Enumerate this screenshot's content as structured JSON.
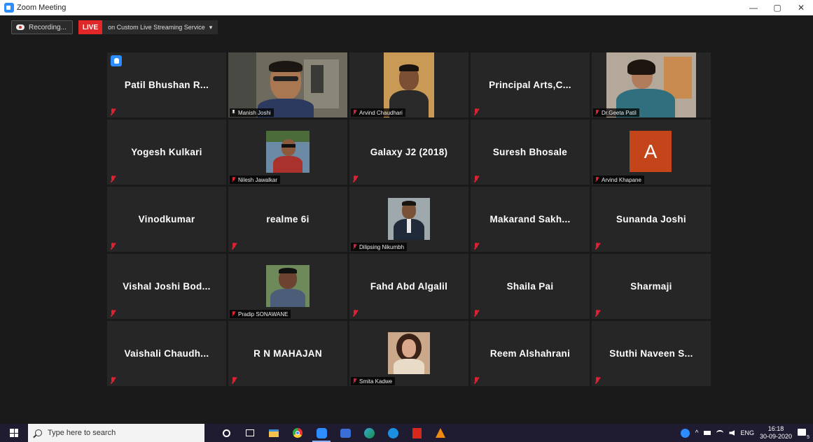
{
  "window": {
    "title": "Zoom Meeting",
    "controls": [
      "—",
      "▢",
      "✕"
    ]
  },
  "topbar": {
    "recording_label": "Recording...",
    "live_badge": "LIVE",
    "live_text": "on Custom Live Streaming Service",
    "live_caret": "▾"
  },
  "participants": [
    {
      "name": "Patil Bhushan R...",
      "type": "name",
      "hand_raised": true
    },
    {
      "name": "Manish Joshi",
      "type": "video",
      "active_speaker": true
    },
    {
      "name": "Arvind Chaudhari",
      "type": "photo"
    },
    {
      "name": "Principal Arts,C...",
      "type": "name"
    },
    {
      "name": "Dr.Geeta Patil",
      "type": "video"
    },
    {
      "name": "Yogesh Kulkari",
      "type": "name"
    },
    {
      "name": "Nilesh Jawalkar",
      "type": "photo"
    },
    {
      "name": "Galaxy J2 (2018)",
      "type": "name"
    },
    {
      "name": "Suresh Bhosale",
      "type": "name"
    },
    {
      "name": "Arvind Khapane",
      "type": "avatar",
      "initial": "A"
    },
    {
      "name": "Vinodkumar",
      "type": "name"
    },
    {
      "name": "realme 6i",
      "type": "name"
    },
    {
      "name": "Dilipsing Nikumbh",
      "type": "photo"
    },
    {
      "name": "Makarand Sakh...",
      "type": "name"
    },
    {
      "name": "Sunanda Joshi",
      "type": "name"
    },
    {
      "name": "Vishal Joshi Bod...",
      "type": "name"
    },
    {
      "name": "Pradip SONAWANE",
      "type": "photo"
    },
    {
      "name": "Fahd Abd Algalil",
      "type": "name"
    },
    {
      "name": "Shaila Pai",
      "type": "name"
    },
    {
      "name": "Sharmaji",
      "type": "name"
    },
    {
      "name": "Vaishali Chaudh...",
      "type": "name"
    },
    {
      "name": "R N MAHAJAN",
      "type": "name"
    },
    {
      "name": "Smita Kadwe",
      "type": "photo"
    },
    {
      "name": "Reem Alshahrani",
      "type": "name"
    },
    {
      "name": "Stuthi Naveen S...",
      "type": "name"
    }
  ],
  "taskbar": {
    "search_placeholder": "Type here to search",
    "language": "ENG",
    "time": "16:18",
    "date": "30-09-2020",
    "notification_count": "5"
  }
}
